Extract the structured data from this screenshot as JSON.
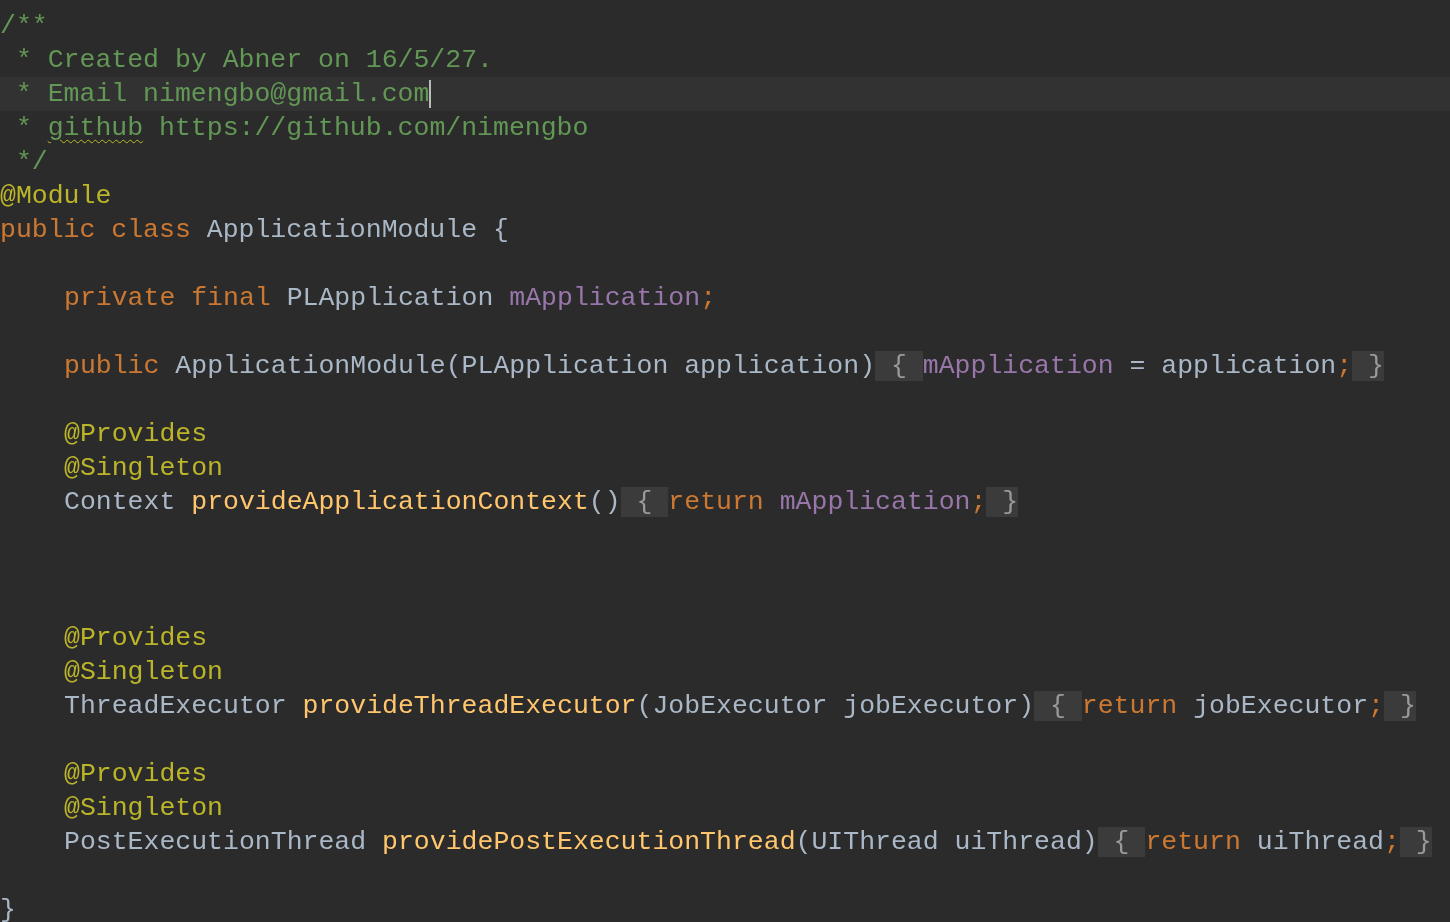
{
  "editor": {
    "lines": [
      {
        "kind": "top",
        "tokens": [
          {
            "kind": "comment",
            "text": "/**"
          }
        ]
      },
      {
        "kind": "top",
        "tokens": [
          {
            "kind": "comment",
            "text": " * Created by Abner on 16/5/27."
          }
        ]
      },
      {
        "kind": "top",
        "current": true,
        "caret": true,
        "tokens": [
          {
            "kind": "comment",
            "text": " * Email nimengbo@gmail.com"
          }
        ]
      },
      {
        "kind": "top",
        "tokens": [
          {
            "kind": "comment",
            "text": " * "
          },
          {
            "kind": "typo",
            "text": "github"
          },
          {
            "kind": "comment",
            "text": " https://github.com/nimengbo"
          }
        ]
      },
      {
        "kind": "top",
        "tokens": [
          {
            "kind": "comment",
            "text": " */"
          }
        ]
      },
      {
        "kind": "top",
        "tokens": [
          {
            "kind": "annotation",
            "text": "@Module"
          }
        ]
      },
      {
        "kind": "top",
        "tokens": [
          {
            "kind": "keyword",
            "text": "public class "
          },
          {
            "kind": "plain",
            "text": "ApplicationModule {"
          }
        ]
      },
      {
        "kind": "blank"
      },
      {
        "kind": "member",
        "tokens": [
          {
            "kind": "keyword",
            "text": "private final "
          },
          {
            "kind": "plain",
            "text": "PLApplication "
          },
          {
            "kind": "field",
            "text": "mApplication"
          },
          {
            "kind": "keyword",
            "text": ";"
          }
        ]
      },
      {
        "kind": "blank"
      },
      {
        "kind": "member",
        "tokens": [
          {
            "kind": "keyword",
            "text": "public "
          },
          {
            "kind": "plain",
            "text": "ApplicationModule(PLApplication application)"
          },
          {
            "kind": "fold",
            "text": " { "
          },
          {
            "kind": "field",
            "text": "mApplication"
          },
          {
            "kind": "plain",
            "text": " = application"
          },
          {
            "kind": "keyword",
            "text": ";"
          },
          {
            "kind": "fold",
            "text": " }"
          }
        ]
      },
      {
        "kind": "blank"
      },
      {
        "kind": "member",
        "tokens": [
          {
            "kind": "annotation",
            "text": "@Provides"
          }
        ]
      },
      {
        "kind": "member",
        "tokens": [
          {
            "kind": "annotation",
            "text": "@Singleton"
          }
        ]
      },
      {
        "kind": "member",
        "tokens": [
          {
            "kind": "plain",
            "text": "Context "
          },
          {
            "kind": "method",
            "text": "provideApplicationContext"
          },
          {
            "kind": "plain",
            "text": "()"
          },
          {
            "kind": "fold",
            "text": " { "
          },
          {
            "kind": "keyword",
            "text": "return "
          },
          {
            "kind": "field",
            "text": "mApplication"
          },
          {
            "kind": "keyword",
            "text": ";"
          },
          {
            "kind": "fold",
            "text": " }"
          }
        ]
      },
      {
        "kind": "blank"
      },
      {
        "kind": "blank"
      },
      {
        "kind": "blank"
      },
      {
        "kind": "member",
        "tokens": [
          {
            "kind": "annotation",
            "text": "@Provides"
          }
        ]
      },
      {
        "kind": "member",
        "tokens": [
          {
            "kind": "annotation",
            "text": "@Singleton"
          }
        ]
      },
      {
        "kind": "member",
        "tokens": [
          {
            "kind": "plain",
            "text": "ThreadExecutor "
          },
          {
            "kind": "method",
            "text": "provideThreadExecutor"
          },
          {
            "kind": "plain",
            "text": "(JobExecutor jobExecutor)"
          },
          {
            "kind": "fold",
            "text": " { "
          },
          {
            "kind": "keyword",
            "text": "return "
          },
          {
            "kind": "plain",
            "text": "jobExecutor"
          },
          {
            "kind": "keyword",
            "text": ";"
          },
          {
            "kind": "fold",
            "text": " }"
          }
        ]
      },
      {
        "kind": "blank"
      },
      {
        "kind": "member",
        "tokens": [
          {
            "kind": "annotation",
            "text": "@Provides"
          }
        ]
      },
      {
        "kind": "member",
        "tokens": [
          {
            "kind": "annotation",
            "text": "@Singleton"
          }
        ]
      },
      {
        "kind": "member",
        "tokens": [
          {
            "kind": "plain",
            "text": "PostExecutionThread "
          },
          {
            "kind": "method",
            "text": "providePostExecutionThread"
          },
          {
            "kind": "plain",
            "text": "(UIThread uiThread)"
          },
          {
            "kind": "fold",
            "text": " { "
          },
          {
            "kind": "keyword",
            "text": "return "
          },
          {
            "kind": "plain",
            "text": "uiThread"
          },
          {
            "kind": "keyword",
            "text": ";"
          },
          {
            "kind": "fold",
            "text": " }"
          }
        ]
      },
      {
        "kind": "blank"
      },
      {
        "kind": "top",
        "tokens": [
          {
            "kind": "plain",
            "text": "}"
          }
        ]
      }
    ]
  }
}
